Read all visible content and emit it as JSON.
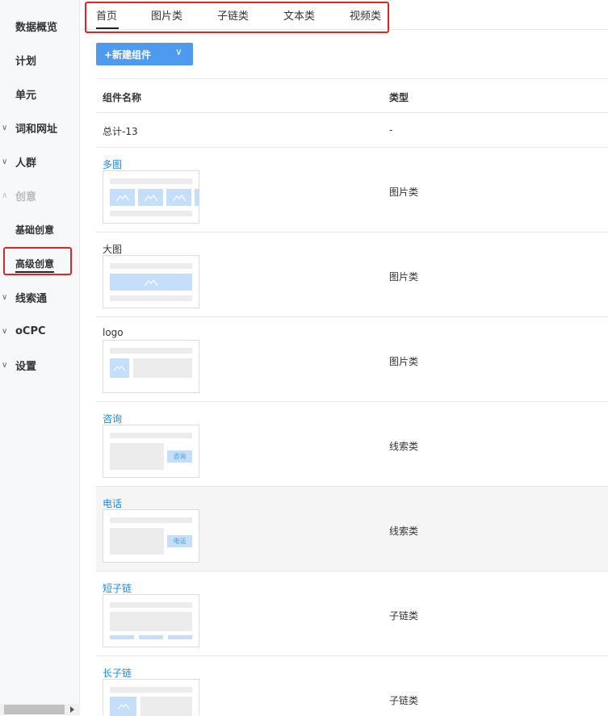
{
  "sidebar": {
    "items": [
      {
        "label": "数据概览",
        "chevron": ""
      },
      {
        "label": "计划",
        "chevron": ""
      },
      {
        "label": "单元",
        "chevron": ""
      },
      {
        "label": "词和网址",
        "chevron": "∨"
      },
      {
        "label": "人群",
        "chevron": "∨"
      },
      {
        "label": "创意",
        "chevron": "∧"
      },
      {
        "label": "基础创意",
        "chevron": ""
      },
      {
        "label": "高级创意",
        "chevron": ""
      },
      {
        "label": "线索通",
        "chevron": "∨"
      },
      {
        "label": "oCPC",
        "chevron": "∨"
      },
      {
        "label": "设置",
        "chevron": "∨"
      }
    ]
  },
  "tabs": [
    {
      "label": "首页"
    },
    {
      "label": "图片类"
    },
    {
      "label": "子链类"
    },
    {
      "label": "文本类"
    },
    {
      "label": "视频类"
    }
  ],
  "toolbar": {
    "new_label": "+新建组件",
    "caret": "∨"
  },
  "table": {
    "headers": {
      "name": "组件名称",
      "type": "类型"
    },
    "total": {
      "name": "总计-13",
      "type": "-"
    },
    "rows": [
      {
        "name": "多图",
        "type": "图片类"
      },
      {
        "name": "大图",
        "type": "图片类"
      },
      {
        "name": "logo",
        "type": "图片类"
      },
      {
        "name": "咨询",
        "type": "线索类",
        "button_text": "咨询"
      },
      {
        "name": "电话",
        "type": "线索类",
        "button_text": "电话"
      },
      {
        "name": "短子链",
        "type": "子链类"
      },
      {
        "name": "长子链",
        "type": "子链类"
      }
    ]
  },
  "colors": {
    "accent": "#4d9bf0",
    "link": "#1e88e5",
    "highlight_border": "#e02424"
  }
}
